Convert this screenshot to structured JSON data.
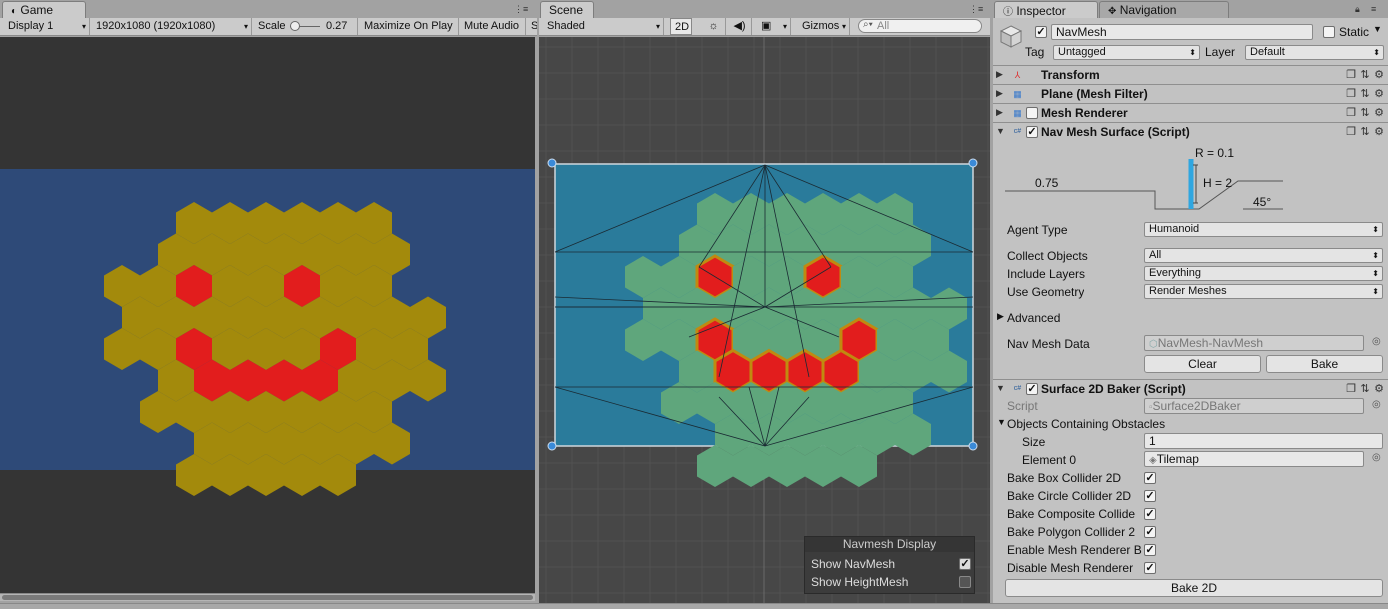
{
  "game": {
    "tab": "Game",
    "display": "Display 1",
    "resolution": "1920x1080 (1920x1080)",
    "scale_label": "Scale",
    "scale_value": "0.27",
    "maximize": "Maximize On Play",
    "mute": "Mute Audio",
    "stats": "S"
  },
  "scene": {
    "tab": "Scene",
    "shading": "Shaded",
    "mode_2d": "2D",
    "gizmos": "Gizmos",
    "search_placeholder": "All",
    "navmesh_display": {
      "title": "Navmesh Display",
      "show_navmesh": "Show NavMesh",
      "show_heightmesh": "Show HeightMesh",
      "show_navmesh_checked": true,
      "show_heightmesh_checked": false
    }
  },
  "inspector": {
    "tab": "Inspector",
    "nav_tab": "Navigation",
    "object_name": "NavMesh",
    "static_label": "Static",
    "tag_label": "Tag",
    "tag_value": "Untagged",
    "layer_label": "Layer",
    "layer_value": "Default",
    "components": {
      "transform": "Transform",
      "mesh_filter": "Plane (Mesh Filter)",
      "mesh_renderer": "Mesh Renderer",
      "nav_mesh_surface": "Nav Mesh Surface (Script)",
      "surface_2d_baker": "Surface 2D Baker (Script)"
    },
    "agent_diagram": {
      "radius": "R = 0.1",
      "height": "H = 2",
      "step": "0.75",
      "slope": "45°"
    },
    "agent_type_label": "Agent Type",
    "agent_type_value": "Humanoid",
    "collect_objects_label": "Collect Objects",
    "collect_objects_value": "All",
    "include_layers_label": "Include Layers",
    "include_layers_value": "Everything",
    "use_geometry_label": "Use Geometry",
    "use_geometry_value": "Render Meshes",
    "advanced_label": "Advanced",
    "nav_mesh_data_label": "Nav Mesh Data",
    "nav_mesh_data_value": "NavMesh-NavMesh",
    "clear_button": "Clear",
    "bake_button": "Bake",
    "script_label": "Script",
    "script_value": "Surface2DBaker",
    "objects_obstacles_label": "Objects Containing Obstacles",
    "size_label": "Size",
    "size_value": "1",
    "element0_label": "Element 0",
    "element0_value": "Tilemap",
    "bake_box": "Bake Box Collider 2D",
    "bake_circle": "Bake Circle Collider 2D",
    "bake_composite": "Bake Composite Collide",
    "bake_polygon": "Bake Polygon Collider 2",
    "enable_renderer": "Enable Mesh Renderer B",
    "disable_renderer": "Disable Mesh Renderer",
    "bake_2d_button": "Bake 2D",
    "checkmark": "✓"
  },
  "colors": {
    "hex_gold": "#a38a0c",
    "hex_red": "#e21d1d",
    "game_bg": "#2e4a78",
    "scene_plane": "#2a7b9b",
    "navmesh_green": "#5fa67c"
  }
}
